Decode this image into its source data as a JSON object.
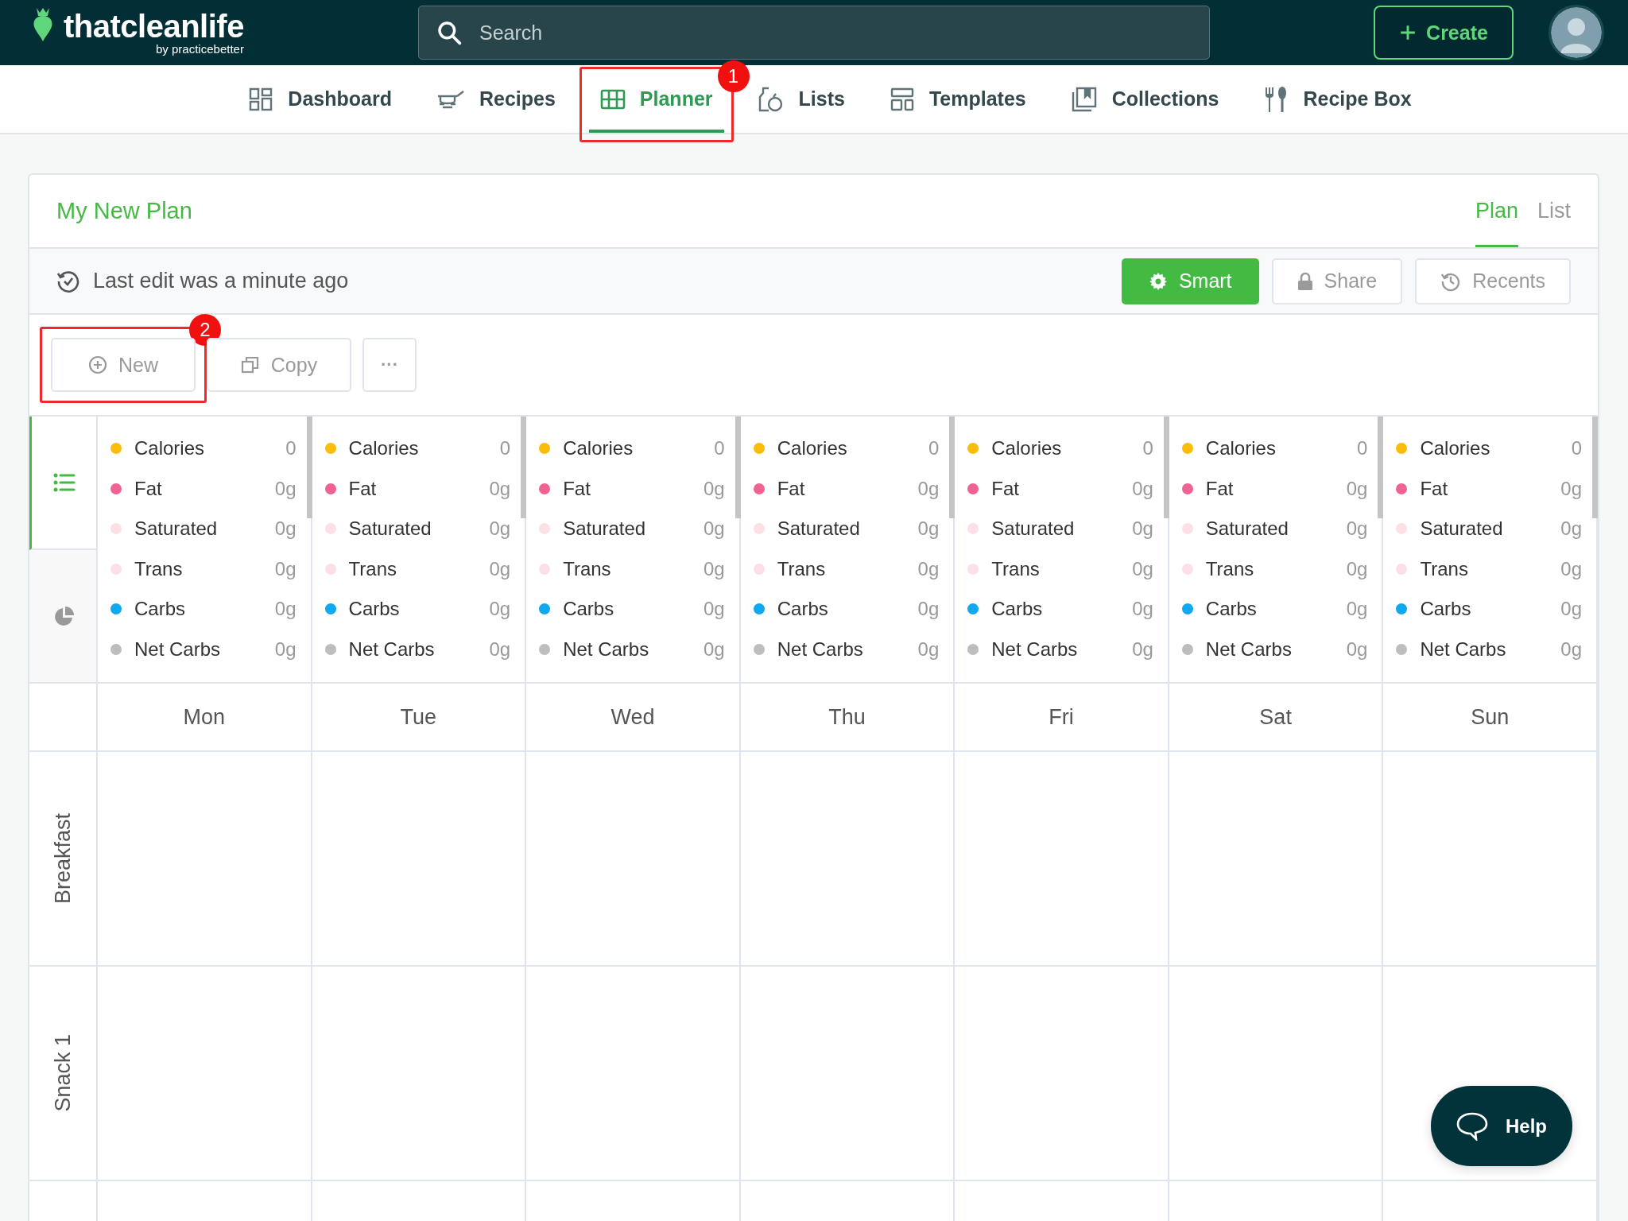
{
  "logo": {
    "name": "thatcleanlife",
    "tagline": "by practicebetter"
  },
  "search": {
    "placeholder": "Search"
  },
  "create_button": {
    "label": "Create"
  },
  "nav": [
    {
      "label": "Dashboard",
      "selected": false
    },
    {
      "label": "Recipes",
      "selected": false
    },
    {
      "label": "Planner",
      "selected": true,
      "annotation": "1"
    },
    {
      "label": "Lists",
      "selected": false
    },
    {
      "label": "Templates",
      "selected": false
    },
    {
      "label": "Collections",
      "selected": false
    },
    {
      "label": "Recipe Box",
      "selected": false
    }
  ],
  "plan": {
    "title": "My New Plan",
    "view_tabs": [
      {
        "label": "Plan",
        "selected": true
      },
      {
        "label": "List",
        "selected": false
      }
    ],
    "last_edit": "Last edit was a minute ago",
    "toolbar_buttons": [
      {
        "label": "Smart",
        "kind": "primary"
      },
      {
        "label": "Share",
        "kind": "share"
      },
      {
        "label": "Recents",
        "kind": "recents"
      }
    ],
    "actions": [
      {
        "label": "New",
        "kind": "new",
        "annotation": "2"
      },
      {
        "label": "Copy",
        "kind": "copy"
      },
      {
        "label": "···",
        "kind": "more"
      }
    ],
    "summary_toggles": [
      {
        "kind": "list",
        "selected": true
      },
      {
        "kind": "pie",
        "selected": false
      }
    ],
    "days": [
      {
        "name": "Mon",
        "nutrients": [
          {
            "name": "Calories",
            "value": "0",
            "color": "#fbbc0a"
          },
          {
            "name": "Fat",
            "value": "0g",
            "color": "#f06292"
          },
          {
            "name": "Saturated",
            "value": "0g",
            "color": "#fde0e6"
          },
          {
            "name": "Trans",
            "value": "0g",
            "color": "#fde0e6"
          },
          {
            "name": "Carbs",
            "value": "0g",
            "color": "#12a8f0"
          },
          {
            "name": "Net Carbs",
            "value": "0g",
            "color": "#bdbdbd"
          }
        ]
      },
      {
        "name": "Tue",
        "nutrients": [
          {
            "name": "Calories",
            "value": "0",
            "color": "#fbbc0a"
          },
          {
            "name": "Fat",
            "value": "0g",
            "color": "#f06292"
          },
          {
            "name": "Saturated",
            "value": "0g",
            "color": "#fde0e6"
          },
          {
            "name": "Trans",
            "value": "0g",
            "color": "#fde0e6"
          },
          {
            "name": "Carbs",
            "value": "0g",
            "color": "#12a8f0"
          },
          {
            "name": "Net Carbs",
            "value": "0g",
            "color": "#bdbdbd"
          }
        ]
      },
      {
        "name": "Wed",
        "nutrients": [
          {
            "name": "Calories",
            "value": "0",
            "color": "#fbbc0a"
          },
          {
            "name": "Fat",
            "value": "0g",
            "color": "#f06292"
          },
          {
            "name": "Saturated",
            "value": "0g",
            "color": "#fde0e6"
          },
          {
            "name": "Trans",
            "value": "0g",
            "color": "#fde0e6"
          },
          {
            "name": "Carbs",
            "value": "0g",
            "color": "#12a8f0"
          },
          {
            "name": "Net Carbs",
            "value": "0g",
            "color": "#bdbdbd"
          }
        ]
      },
      {
        "name": "Thu",
        "nutrients": [
          {
            "name": "Calories",
            "value": "0",
            "color": "#fbbc0a"
          },
          {
            "name": "Fat",
            "value": "0g",
            "color": "#f06292"
          },
          {
            "name": "Saturated",
            "value": "0g",
            "color": "#fde0e6"
          },
          {
            "name": "Trans",
            "value": "0g",
            "color": "#fde0e6"
          },
          {
            "name": "Carbs",
            "value": "0g",
            "color": "#12a8f0"
          },
          {
            "name": "Net Carbs",
            "value": "0g",
            "color": "#bdbdbd"
          }
        ]
      },
      {
        "name": "Fri",
        "nutrients": [
          {
            "name": "Calories",
            "value": "0",
            "color": "#fbbc0a"
          },
          {
            "name": "Fat",
            "value": "0g",
            "color": "#f06292"
          },
          {
            "name": "Saturated",
            "value": "0g",
            "color": "#fde0e6"
          },
          {
            "name": "Trans",
            "value": "0g",
            "color": "#fde0e6"
          },
          {
            "name": "Carbs",
            "value": "0g",
            "color": "#12a8f0"
          },
          {
            "name": "Net Carbs",
            "value": "0g",
            "color": "#bdbdbd"
          }
        ]
      },
      {
        "name": "Sat",
        "nutrients": [
          {
            "name": "Calories",
            "value": "0",
            "color": "#fbbc0a"
          },
          {
            "name": "Fat",
            "value": "0g",
            "color": "#f06292"
          },
          {
            "name": "Saturated",
            "value": "0g",
            "color": "#fde0e6"
          },
          {
            "name": "Trans",
            "value": "0g",
            "color": "#fde0e6"
          },
          {
            "name": "Carbs",
            "value": "0g",
            "color": "#12a8f0"
          },
          {
            "name": "Net Carbs",
            "value": "0g",
            "color": "#bdbdbd"
          }
        ]
      },
      {
        "name": "Sun",
        "nutrients": [
          {
            "name": "Calories",
            "value": "0",
            "color": "#fbbc0a"
          },
          {
            "name": "Fat",
            "value": "0g",
            "color": "#f06292"
          },
          {
            "name": "Saturated",
            "value": "0g",
            "color": "#fde0e6"
          },
          {
            "name": "Trans",
            "value": "0g",
            "color": "#fde0e6"
          },
          {
            "name": "Carbs",
            "value": "0g",
            "color": "#12a8f0"
          },
          {
            "name": "Net Carbs",
            "value": "0g",
            "color": "#bdbdbd"
          }
        ]
      }
    ],
    "meals": [
      {
        "name": "Breakfast"
      },
      {
        "name": "Snack 1"
      }
    ]
  },
  "help_button": {
    "label": "Help"
  }
}
